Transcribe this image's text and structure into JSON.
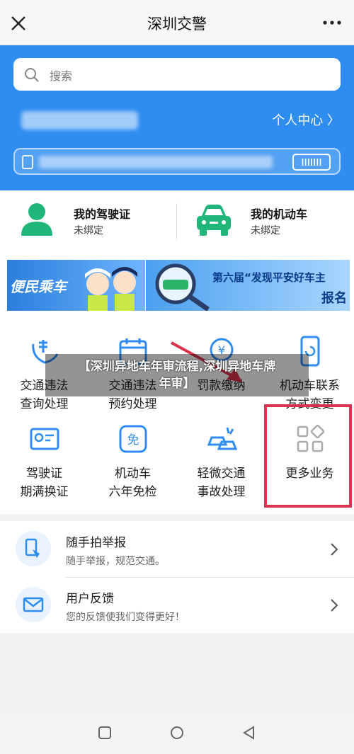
{
  "header": {
    "title": "深圳交警"
  },
  "search": {
    "placeholder": "搜索"
  },
  "profile": {
    "user_center": "个人中心 〉"
  },
  "bindings": [
    {
      "title": "我的驾驶证",
      "status": "未绑定"
    },
    {
      "title": "我的机动车",
      "status": "未绑定"
    }
  ],
  "banners": {
    "left_text": "便民乘车",
    "right_title": "第六届“发现平安好车主",
    "right_sub": "报名"
  },
  "services": [
    {
      "line1": "交通违法",
      "line2": "查询处理"
    },
    {
      "line1": "交通违法",
      "line2": "预约处理"
    },
    {
      "line1": "罚款缴纳",
      "line2": ""
    },
    {
      "line1": "机动车联系",
      "line2": "方式变更"
    },
    {
      "line1": "驾驶证",
      "line2": "期满换证"
    },
    {
      "line1": "机动车",
      "line2": "六年免检"
    },
    {
      "line1": "轻微交通",
      "line2": "事故处理"
    },
    {
      "line1": "更多业务",
      "line2": ""
    }
  ],
  "overlay": {
    "line1": "【深圳异地车年审流程,深圳异地车牌",
    "line2": "年审】"
  },
  "list": [
    {
      "title": "随手拍举报",
      "subtitle": "随手举报，规范交通。"
    },
    {
      "title": "用户反馈",
      "subtitle": "您的反馈使我们变得更好！"
    }
  ],
  "colors": {
    "brand_blue": "#2f8cf0",
    "highlight_red": "#d9324c",
    "icon_green": "#21b77a"
  }
}
